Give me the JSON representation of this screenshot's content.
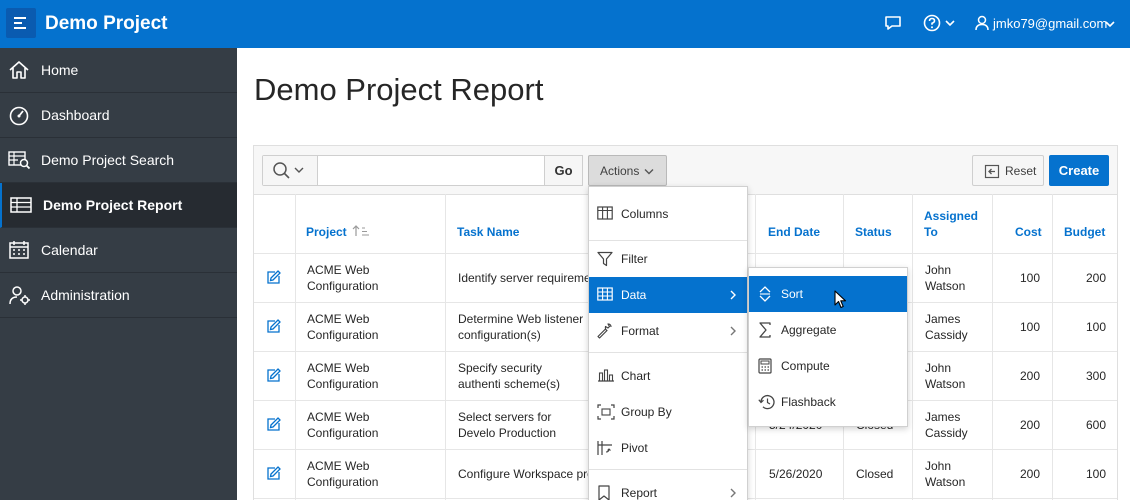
{
  "header": {
    "app_title": "Demo Project",
    "user": "jmko79@gmail.com",
    "icons": [
      "menu-icon",
      "chat-icon",
      "help-icon",
      "user-icon"
    ],
    "brand_color": "#0572ce"
  },
  "sidebar": {
    "items": [
      {
        "label": "Home",
        "icon": "home-icon"
      },
      {
        "label": "Dashboard",
        "icon": "dashboard-icon"
      },
      {
        "label": "Demo Project Search",
        "icon": "search-report-icon"
      },
      {
        "label": "Demo Project Report",
        "icon": "table-icon",
        "active": true
      },
      {
        "label": "Calendar",
        "icon": "calendar-icon"
      },
      {
        "label": "Administration",
        "icon": "admin-icon"
      }
    ]
  },
  "main": {
    "title": "Demo Project Report",
    "toolbar": {
      "go_label": "Go",
      "actions_label": "Actions",
      "reset_label": "Reset",
      "create_label": "Create",
      "search_value": ""
    },
    "table": {
      "columns": [
        "Project",
        "Task Name",
        "End Date",
        "Status",
        "Assigned To",
        "Cost",
        "Budget"
      ],
      "rows": [
        {
          "project": "ACME Web Configuration",
          "task": "Identify server requireme",
          "end_date": "",
          "status": "",
          "assigned": "John Watson",
          "cost": "100",
          "budget": "200"
        },
        {
          "project": "ACME Web Configuration",
          "task": "Determine Web listener configuration(s)",
          "end_date": "",
          "status": "",
          "assigned": "James Cassidy",
          "cost": "100",
          "budget": "100"
        },
        {
          "project": "ACME Web Configuration",
          "task": "Specify security authenti scheme(s)",
          "end_date": "",
          "status": "",
          "assigned": "John Watson",
          "cost": "200",
          "budget": "300"
        },
        {
          "project": "ACME Web Configuration",
          "task": "Select servers for Develo Production",
          "end_date": "5/24/2020",
          "status": "Closed",
          "assigned": "James Cassidy",
          "cost": "200",
          "budget": "600"
        },
        {
          "project": "ACME Web Configuration",
          "task": "Configure Workspace pro",
          "end_date": "5/26/2020",
          "status": "Closed",
          "assigned": "John Watson",
          "cost": "200",
          "budget": "100"
        }
      ]
    }
  },
  "actions_menu": {
    "items": [
      {
        "label": "Columns",
        "icon": "columns-icon"
      },
      {
        "label": "Filter",
        "icon": "filter-icon"
      },
      {
        "label": "Data",
        "icon": "table-icon",
        "has_submenu": true,
        "highlighted": true
      },
      {
        "label": "Format",
        "icon": "wrench-icon",
        "has_submenu": true
      },
      {
        "label": "Chart",
        "icon": "chart-icon"
      },
      {
        "label": "Group By",
        "icon": "group-by-icon"
      },
      {
        "label": "Pivot",
        "icon": "pivot-icon"
      },
      {
        "label": "Report",
        "icon": "bookmark-icon",
        "has_submenu": true
      }
    ],
    "data_submenu": [
      {
        "label": "Sort",
        "icon": "sort-icon",
        "highlighted": true
      },
      {
        "label": "Aggregate",
        "icon": "sigma-icon"
      },
      {
        "label": "Compute",
        "icon": "calculator-icon"
      },
      {
        "label": "Flashback",
        "icon": "history-icon"
      }
    ]
  }
}
